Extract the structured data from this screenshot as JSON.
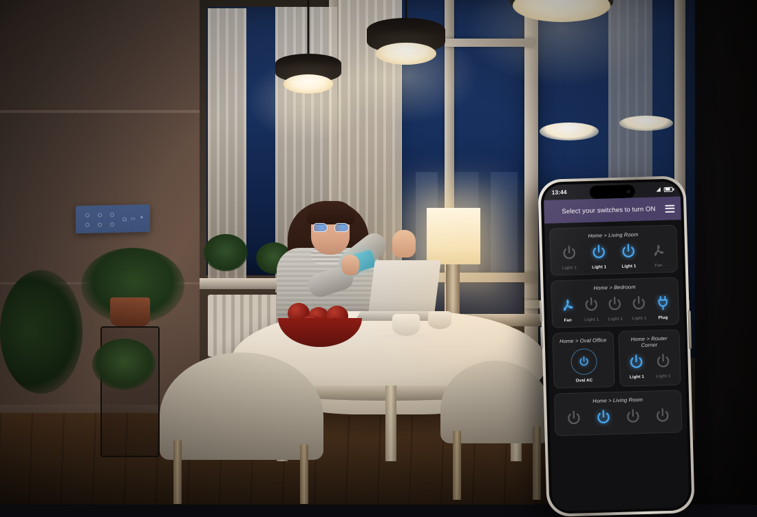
{
  "scene": {
    "description": "Woman at dining table using voice assistant on smartphone in a dimly lit modern apartment at dusk",
    "room_items": [
      "pendant-lamp",
      "pendant-lamp",
      "pendant-lamp",
      "table-lamp",
      "laptop",
      "fruit-bowl",
      "coffee-cup",
      "fern-plant",
      "wall-smart-panel",
      "dining-chair",
      "dining-chair"
    ]
  },
  "phone": {
    "status_bar": {
      "time": "13:44",
      "signal_icon": "signal-bars-icon",
      "battery_icon": "battery-icon"
    },
    "app_bar": {
      "title": "Select your switches to turn ON",
      "menu_icon": "hamburger-menu-icon",
      "background_color": "#4b4067"
    },
    "theme": {
      "screen_background": "#111113",
      "card_background": "#1e1e20",
      "accent_on": "#49a8f2",
      "accent_off": "#5a5a5f",
      "label_on": "#f2f2f4",
      "label_off": "#5e5e63"
    },
    "cards": [
      {
        "title": "Home > Living Room",
        "layout": "full",
        "switches": [
          {
            "label": "Light 1",
            "icon": "power-icon",
            "state": "off"
          },
          {
            "label": "Light 1",
            "icon": "power-icon",
            "state": "on"
          },
          {
            "label": "Light 1",
            "icon": "power-icon",
            "state": "on"
          },
          {
            "label": "Fan",
            "icon": "fan-icon",
            "state": "off"
          }
        ]
      },
      {
        "title": "Home > Bedroom",
        "layout": "full",
        "switches": [
          {
            "label": "Fan",
            "icon": "fan-icon",
            "state": "on"
          },
          {
            "label": "Light 1",
            "icon": "power-icon",
            "state": "off"
          },
          {
            "label": "Light 1",
            "icon": "power-icon",
            "state": "off"
          },
          {
            "label": "Light 1",
            "icon": "power-icon",
            "state": "off"
          },
          {
            "label": "Plug",
            "icon": "plug-icon",
            "state": "on"
          }
        ]
      },
      {
        "title": "Home > Oval Office",
        "layout": "half",
        "switches": [
          {
            "label": "Oval AC",
            "icon": "power-ringed-icon",
            "state": "on"
          }
        ]
      },
      {
        "title": "Home > Router Corner",
        "layout": "half",
        "switches": [
          {
            "label": "Light 1",
            "icon": "power-icon",
            "state": "on"
          },
          {
            "label": "Light 1",
            "icon": "power-icon",
            "state": "off"
          }
        ]
      },
      {
        "title": "Home > Living Room",
        "layout": "full",
        "switches": [
          {
            "label": "",
            "icon": "power-icon",
            "state": "off"
          },
          {
            "label": "",
            "icon": "power-icon",
            "state": "on"
          },
          {
            "label": "",
            "icon": "power-icon",
            "state": "off"
          },
          {
            "label": "",
            "icon": "power-icon",
            "state": "off"
          }
        ]
      }
    ]
  }
}
